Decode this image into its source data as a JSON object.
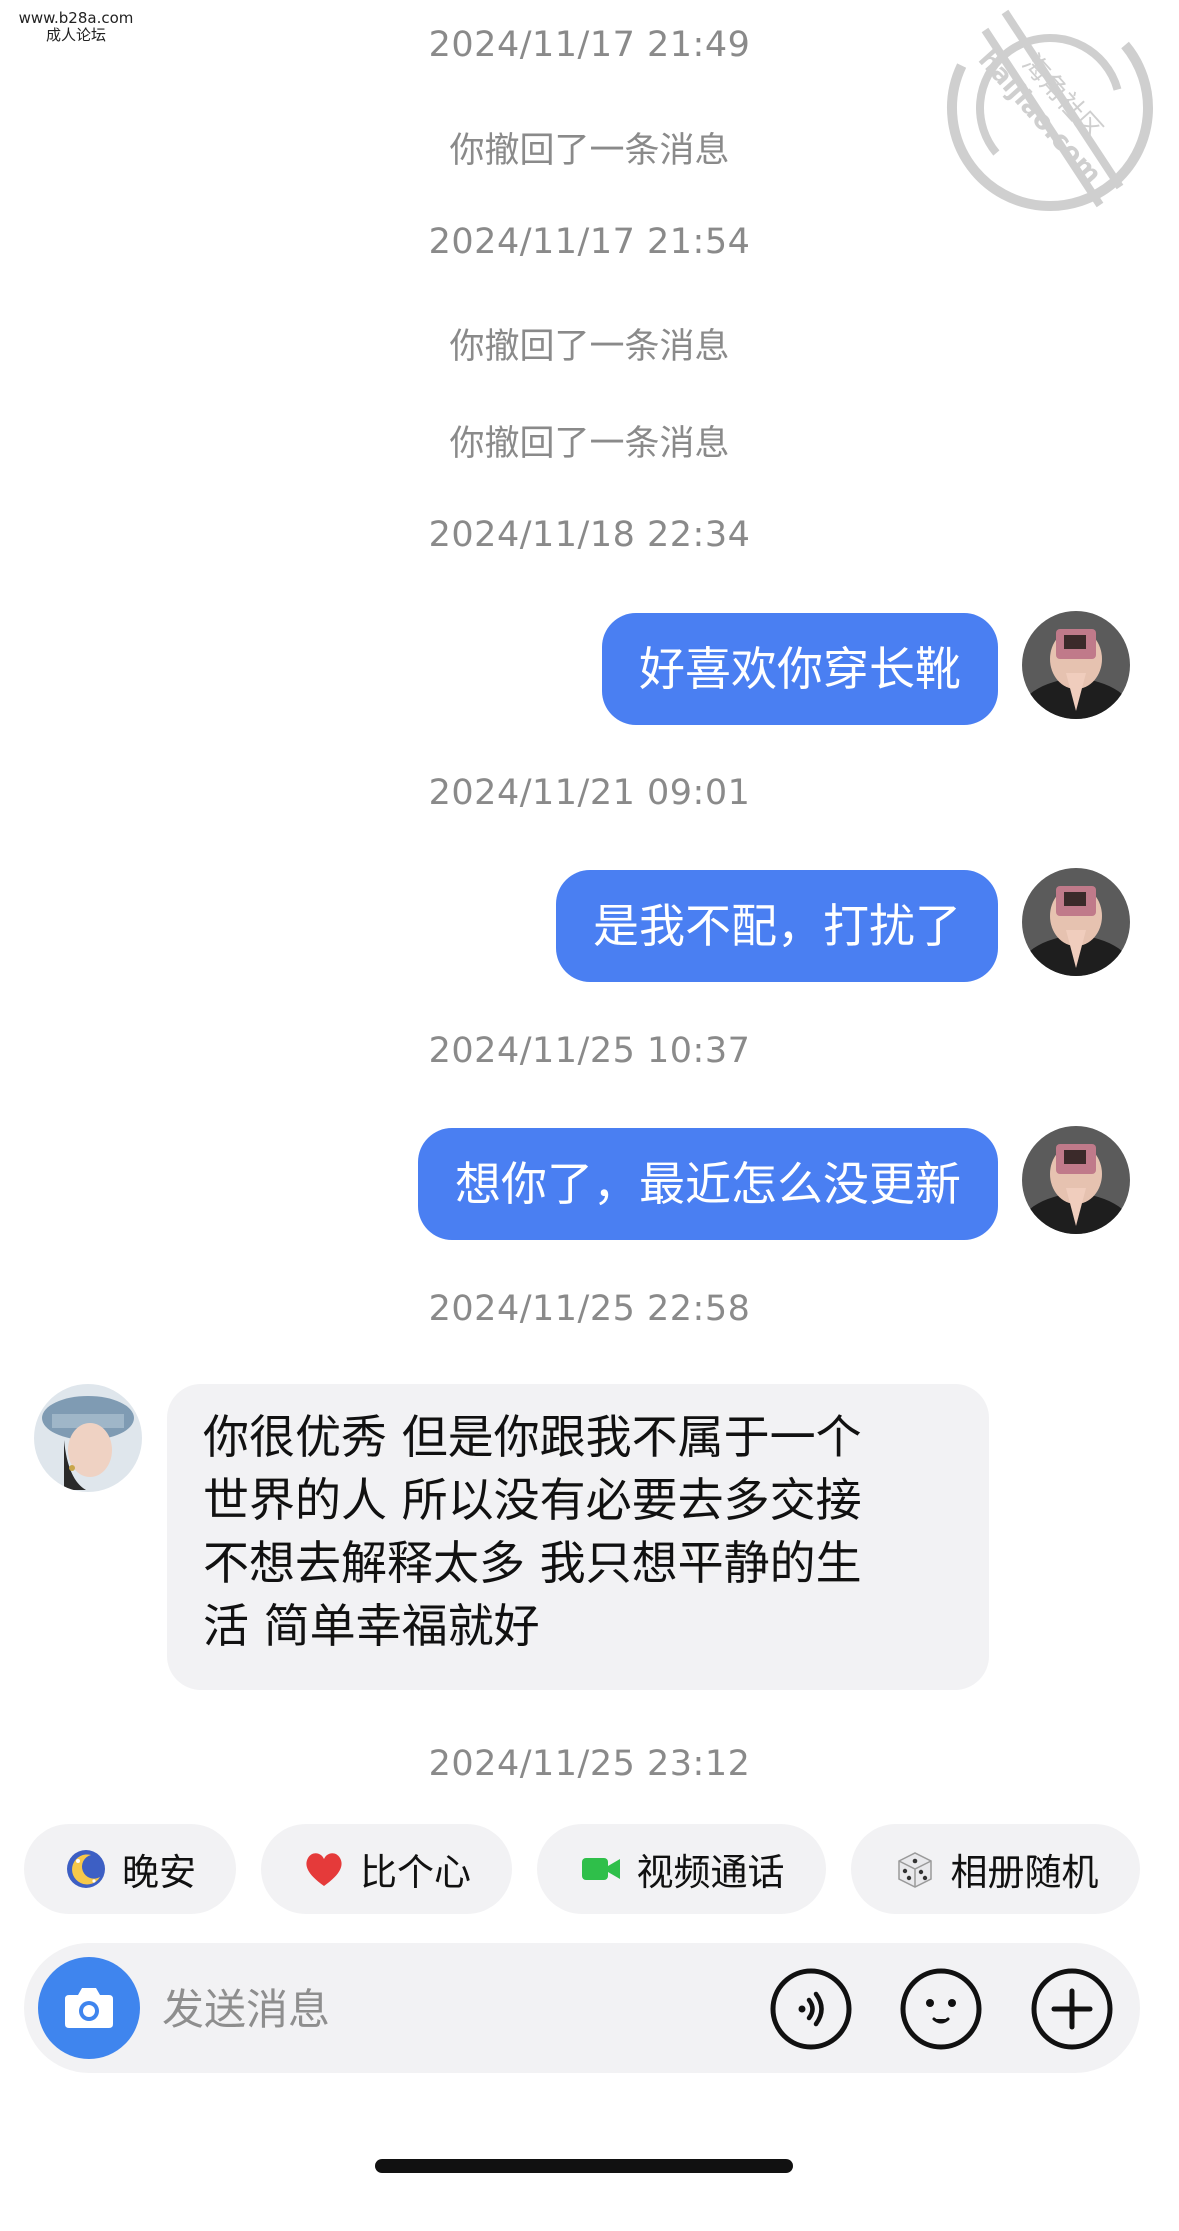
{
  "site_mark": {
    "line1": "www.b28a.com",
    "line2": "成人论坛"
  },
  "watermark": {
    "line1": "海角社区",
    "line2": "haijiao.com"
  },
  "messages": {
    "ts1": "2024/11/17 21:49",
    "sys1": "你撤回了一条消息",
    "ts2": "2024/11/17 21:54",
    "sys2": "你撤回了一条消息",
    "sys3": "你撤回了一条消息",
    "ts3": "2024/11/18 22:34",
    "out1": "好喜欢你穿长靴",
    "ts4": "2024/11/21 09:01",
    "out2": "是我不配，打扰了",
    "ts5": "2024/11/25 10:37",
    "out3": "想你了，最近怎么没更新",
    "ts6": "2024/11/25 22:58",
    "in1": {
      "lines": [
        "你很优秀 但是你跟我不属于一个",
        "世界的人  所以没有必要去多交接",
        "不想去解释太多  我只想平静的生",
        "活 简单幸福就好"
      ]
    },
    "ts7": "2024/11/25 23:12"
  },
  "quick_replies": [
    {
      "label": "晚安",
      "icon": "moon-icon"
    },
    {
      "label": "比个心",
      "icon": "heart-icon"
    },
    {
      "label": "视频通话",
      "icon": "video-camera-icon"
    },
    {
      "label": "相册随机",
      "icon": "dice-icon"
    }
  ],
  "composer": {
    "placeholder": "发送消息",
    "buttons": [
      "camera-icon",
      "voice-icon",
      "emoji-icon",
      "plus-icon"
    ]
  },
  "colors": {
    "outgoing_bubble": "#4a7ff2",
    "incoming_bubble": "#f2f2f4",
    "timestamp": "#8a8a8a",
    "camera_button": "#3f85ee"
  }
}
